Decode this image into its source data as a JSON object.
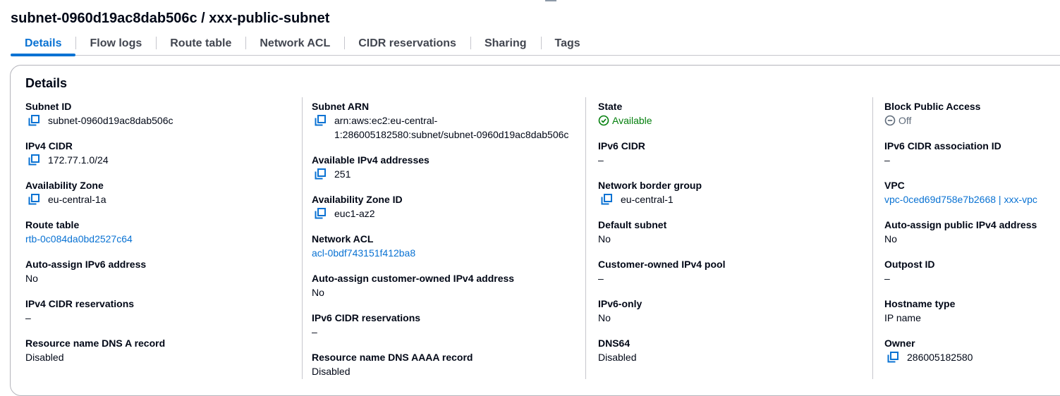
{
  "page": {
    "title": "subnet-0960d19ac8dab506c / xxx-public-subnet"
  },
  "tabs": [
    {
      "label": "Details",
      "active": true
    },
    {
      "label": "Flow logs"
    },
    {
      "label": "Route table"
    },
    {
      "label": "Network ACL"
    },
    {
      "label": "CIDR reservations"
    },
    {
      "label": "Sharing"
    },
    {
      "label": "Tags"
    }
  ],
  "details": {
    "title": "Details",
    "colors": {
      "accent": "#0972d3",
      "success": "#037f0c",
      "muted": "#5f6b7a"
    },
    "columns": [
      [
        {
          "label": "Subnet ID",
          "value": "subnet-0960d19ac8dab506c",
          "copy": true
        },
        {
          "label": "IPv4 CIDR",
          "value": "172.77.1.0/24",
          "copy": true
        },
        {
          "label": "Availability Zone",
          "value": "eu-central-1a",
          "copy": true
        },
        {
          "label": "Route table",
          "value": "rtb-0c084da0bd2527c64",
          "link": true
        },
        {
          "label": "Auto-assign IPv6 address",
          "value": "No"
        },
        {
          "label": "IPv4 CIDR reservations",
          "value": "–"
        },
        {
          "label": "Resource name DNS A record",
          "value": "Disabled"
        }
      ],
      [
        {
          "label": "Subnet ARN",
          "value": "arn:aws:ec2:eu-central-\n1:286005182580:subnet/subnet-0960d19ac8dab506c",
          "copy": true
        },
        {
          "label": "Available IPv4 addresses",
          "value": "251",
          "copy": true
        },
        {
          "label": "Availability Zone ID",
          "value": "euc1-az2",
          "copy": true
        },
        {
          "label": "Network ACL",
          "value": "acl-0bdf743151f412ba8",
          "link": true
        },
        {
          "label": "Auto-assign customer-owned IPv4 address",
          "value": "No"
        },
        {
          "label": "IPv6 CIDR reservations",
          "value": "–"
        },
        {
          "label": "Resource name DNS AAAA record",
          "value": "Disabled"
        }
      ],
      [
        {
          "label": "State",
          "value": "Available",
          "status": "success"
        },
        {
          "label": "IPv6 CIDR",
          "value": "–"
        },
        {
          "label": "Network border group",
          "value": "eu-central-1",
          "copy": true
        },
        {
          "label": "Default subnet",
          "value": "No"
        },
        {
          "label": "Customer-owned IPv4 pool",
          "value": "–"
        },
        {
          "label": "IPv6-only",
          "value": "No"
        },
        {
          "label": "DNS64",
          "value": "Disabled"
        }
      ],
      [
        {
          "label": "Block Public Access",
          "value": "Off",
          "status": "stopped"
        },
        {
          "label": "IPv6 CIDR association ID",
          "value": "–"
        },
        {
          "label": "VPC",
          "value": "vpc-0ced69d758e7b2668 | xxx-vpc",
          "link": true
        },
        {
          "label": "Auto-assign public IPv4 address",
          "value": "No"
        },
        {
          "label": "Outpost ID",
          "value": "–"
        },
        {
          "label": "Hostname type",
          "value": "IP name"
        },
        {
          "label": "Owner",
          "value": "286005182580",
          "copy": true
        }
      ]
    ]
  }
}
